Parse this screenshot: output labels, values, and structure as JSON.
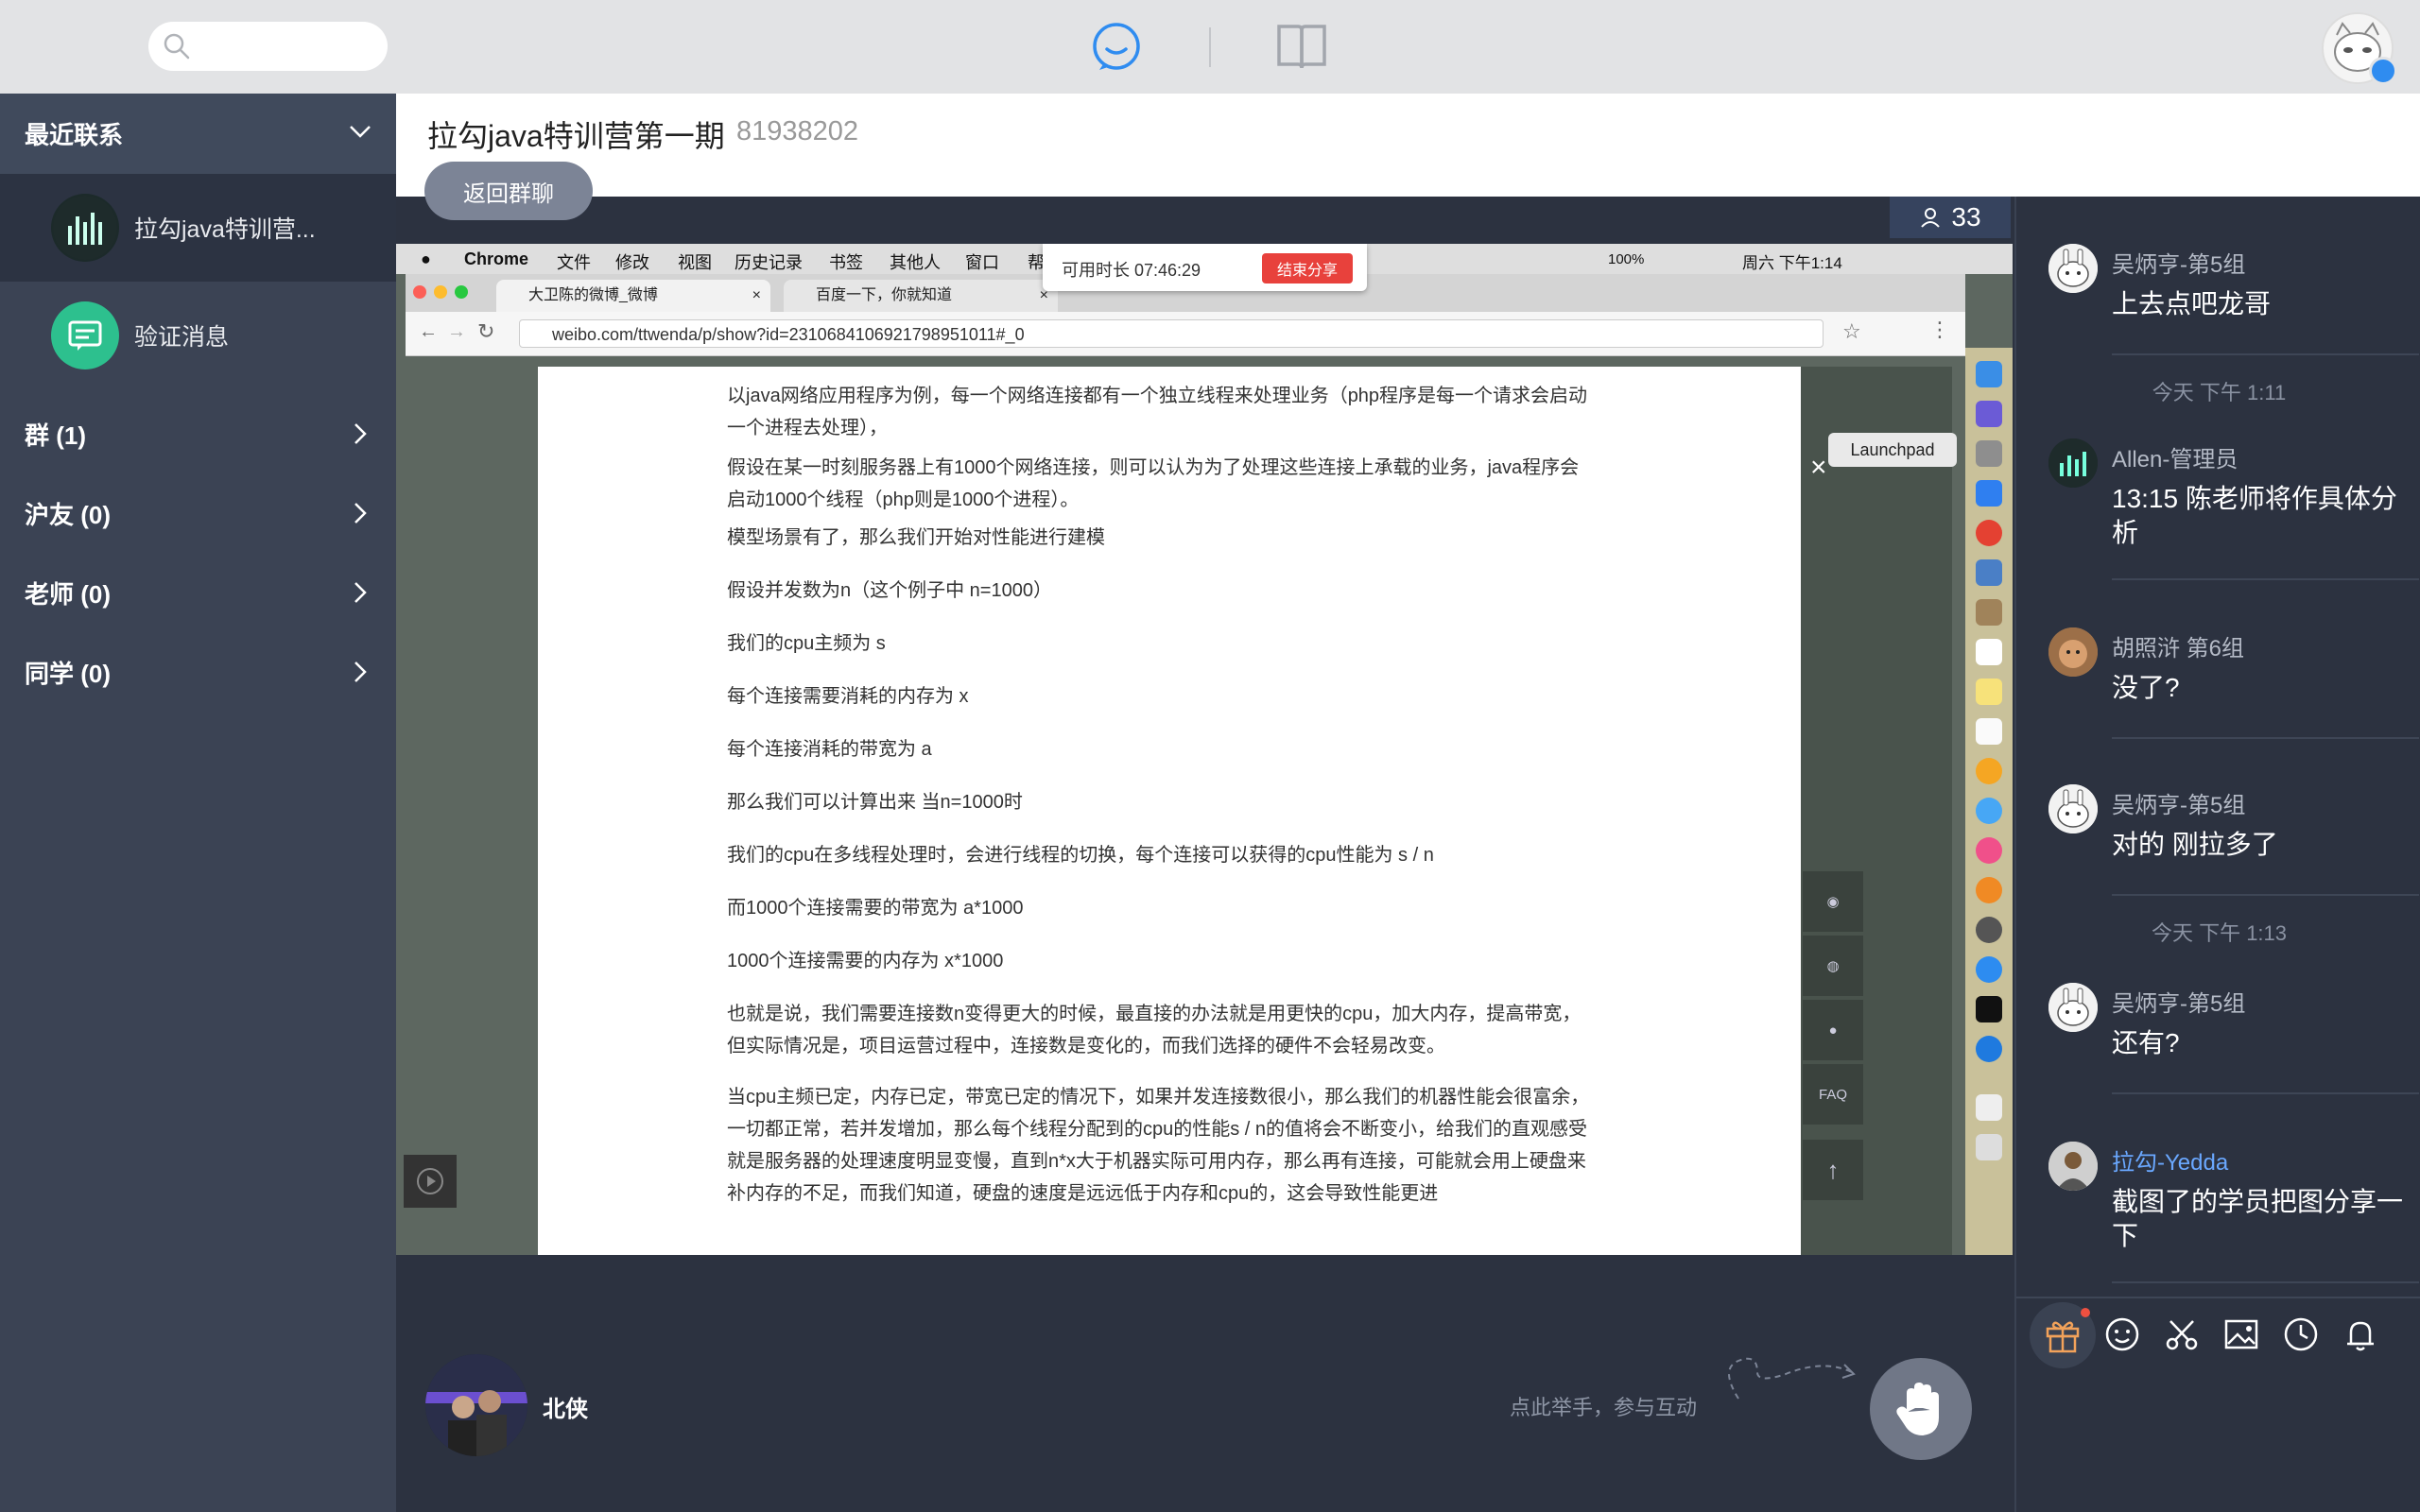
{
  "topbar": {
    "search_placeholder": "",
    "icons": [
      "search-icon",
      "chat-bubble-icon",
      "book-icon",
      "user-avatar"
    ]
  },
  "sidebar": {
    "recent_label": "最近联系",
    "contacts": [
      {
        "name": "拉勾java特训营...",
        "icon": "group-avatar",
        "active": true
      },
      {
        "name": "验证消息",
        "icon": "message-icon",
        "active": false
      }
    ],
    "sections": [
      {
        "label": "群 (1)"
      },
      {
        "label": "沪友 (0)"
      },
      {
        "label": "老师 (0)"
      },
      {
        "label": "同学 (0)"
      }
    ]
  },
  "main": {
    "group_title": "拉勾java特训营第一期",
    "group_id": "81938202",
    "back_label": "返回群聊",
    "viewer_count": "33",
    "presenter_name": "北侠",
    "raise_hint": "点此举手，参与互动"
  },
  "shared_screen": {
    "menubar": {
      "app": "Chrome",
      "items": [
        "文件",
        "修改",
        "视图",
        "历史记录",
        "书签",
        "其他人",
        "窗口",
        "帮"
      ],
      "battery": "100%",
      "clock": "周六 下午1:14"
    },
    "timer_label": "可用时长 07:46:29",
    "end_share_label": "结束分享",
    "tabs": [
      "大卫陈的微博_微博",
      "百度一下，你就知道"
    ],
    "url": "weibo.com/ttwenda/p/show?id=2310684106921798951011#_0",
    "launchpad_tooltip": "Launchpad",
    "side_faq": "FAQ",
    "paragraphs": [
      "以java网络应用程序为例，每一个网络连接都有一个独立线程来处理业务（php程序是每一个请求会启动一个进程去处理），",
      "假设在某一时刻服务器上有1000个网络连接，则可以认为为了处理这些连接上承载的业务，java程序会启动1000个线程（php则是1000个进程）。",
      "模型场景有了，那么我们开始对性能进行建模",
      "假设并发数为n（这个例子中 n=1000）",
      "我们的cpu主频为 s",
      "每个连接需要消耗的内存为 x",
      "每个连接消耗的带宽为 a",
      "那么我们可以计算出来 当n=1000时",
      "我们的cpu在多线程处理时，会进行线程的切换，每个连接可以获得的cpu性能为  s / n",
      "而1000个连接需要的带宽为 a*1000",
      "1000个连接需要的内存为 x*1000",
      "也就是说，我们需要连接数n变得更大的时候，最直接的办法就是用更快的cpu，加大内存，提高带宽，但实际情况是，项目运营过程中，连接数是变化的，而我们选择的硬件不会轻易改变。",
      "当cpu主频已定，内存已定，带宽已定的情况下，如果并发连接数很小，那么我们的机器性能会很富余，一切都正常，若并发增加，那么每个线程分配到的cpu的性能s / n的值将会不断变小，给我们的直观感受就是服务器的处理速度明显变慢，直到n*x大于机器实际可用内存，那么再有连接，可能就会用上硬盘来补内存的不足，而我们知道，硬盘的速度是远远低于内存和cpu的，这会导致性能更进"
    ]
  },
  "chat": {
    "messages": [
      {
        "sender": "吴炳亨-第5组",
        "text": "上去点吧龙哥"
      },
      {
        "sender": "Allen-管理员",
        "text": "13:15 陈老师将作具体分析"
      },
      {
        "sender": "胡照浒 第6组",
        "text": "没了?"
      },
      {
        "sender": "吴炳亨-第5组",
        "text": "对的 刚拉多了"
      },
      {
        "sender": "吴炳亨-第5组",
        "text": "还有?"
      },
      {
        "sender": "拉勾-Yedda",
        "text": "截图了的学员把图分享一下"
      }
    ],
    "timestamps": [
      "今天 下午 1:11",
      "今天 下午 1:13"
    ],
    "sender_highlight_color": "#6aa8ff",
    "toolbar_icons": [
      "gift-icon",
      "emoji-icon",
      "scissors-icon",
      "image-icon",
      "clock-icon",
      "bell-icon"
    ]
  },
  "colors": {
    "sidebar_bg": "#3b4354",
    "main_dark": "#2c3240",
    "accent_green": "#2dc08e",
    "accent_blue": "#2f8cf0"
  }
}
